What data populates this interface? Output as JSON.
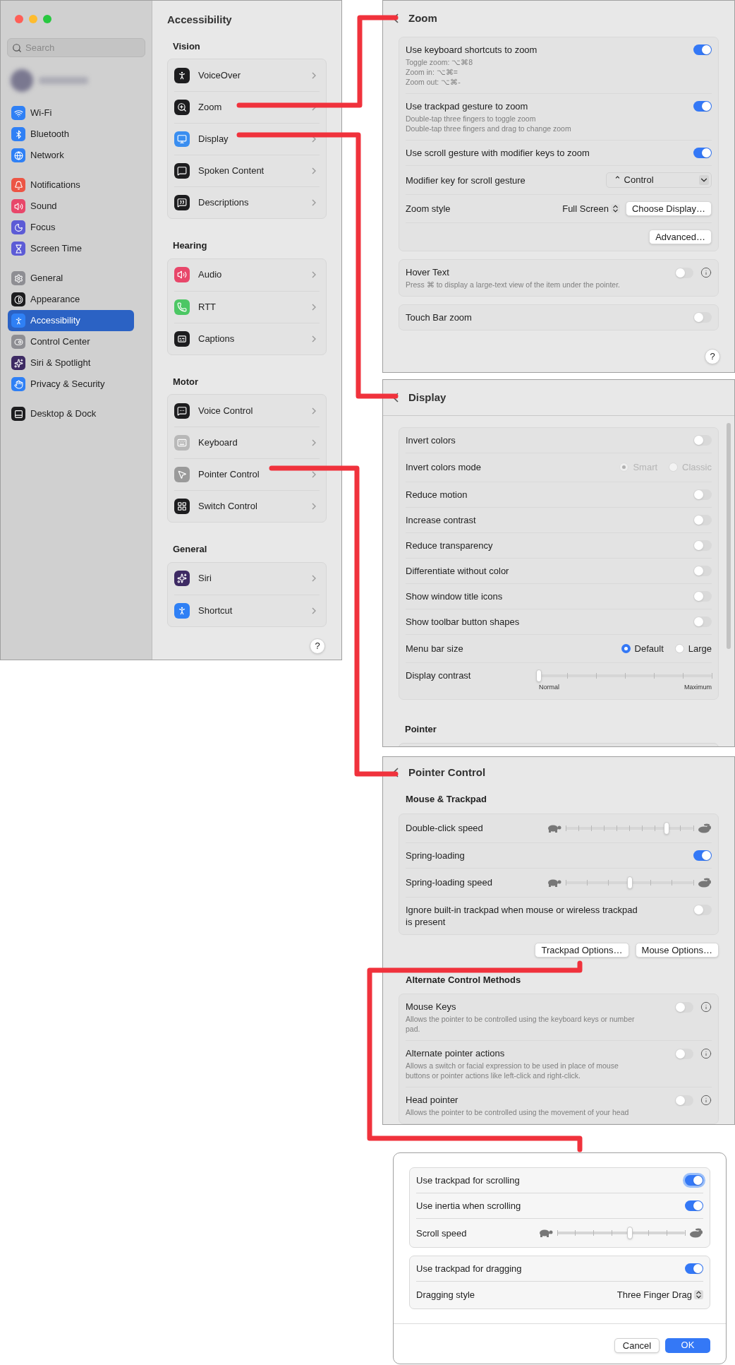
{
  "main_window": {
    "sidebar": {
      "search": {
        "placeholder": "Search"
      },
      "groups": [
        {
          "items": [
            {
              "label": "Wi-Fi",
              "color": "#2f80f5",
              "selected": false
            },
            {
              "label": "Bluetooth",
              "color": "#2f80f5",
              "selected": false
            },
            {
              "label": "Network",
              "color": "#2f80f5",
              "selected": false
            }
          ]
        },
        {
          "items": [
            {
              "label": "Notifications",
              "color": "#ec5545",
              "selected": false
            },
            {
              "label": "Sound",
              "color": "#e8476a",
              "selected": false
            },
            {
              "label": "Focus",
              "color": "#5c5bd6",
              "selected": false
            },
            {
              "label": "Screen Time",
              "color": "#5c5bd6",
              "selected": false
            }
          ]
        },
        {
          "items": [
            {
              "label": "General",
              "color": "#8e8e93",
              "selected": false
            },
            {
              "label": "Appearance",
              "color": "#1d1d1f",
              "selected": false
            },
            {
              "label": "Accessibility",
              "color": "#2f80f5",
              "selected": true
            },
            {
              "label": "Control Center",
              "color": "#8e8e93",
              "selected": false
            },
            {
              "label": "Siri & Spotlight",
              "color": "#3d2a63",
              "selected": false
            },
            {
              "label": "Privacy & Security",
              "color": "#2f80f5",
              "selected": false
            }
          ]
        },
        {
          "items": [
            {
              "label": "Desktop & Dock",
              "color": "#1d1d1f",
              "selected": false
            }
          ]
        }
      ]
    },
    "content": {
      "title": "Accessibility",
      "sections": [
        {
          "heading": "Vision",
          "items": [
            {
              "label": "VoiceOver",
              "color": "#1d1d1f"
            },
            {
              "label": "Zoom",
              "color": "#1d1d1f"
            },
            {
              "label": "Display",
              "color": "#3a8ef0"
            },
            {
              "label": "Spoken Content",
              "color": "#1d1d1f"
            },
            {
              "label": "Descriptions",
              "color": "#1d1d1f"
            }
          ]
        },
        {
          "heading": "Hearing",
          "items": [
            {
              "label": "Audio",
              "color": "#e8476a"
            },
            {
              "label": "RTT",
              "color": "#4cc764"
            },
            {
              "label": "Captions",
              "color": "#1d1d1f"
            }
          ]
        },
        {
          "heading": "Motor",
          "items": [
            {
              "label": "Voice Control",
              "color": "#1d1d1f"
            },
            {
              "label": "Keyboard",
              "color": "#b8b8b8"
            },
            {
              "label": "Pointer Control",
              "color": "#9a9a9a"
            },
            {
              "label": "Switch Control",
              "color": "#1d1d1f"
            }
          ]
        },
        {
          "heading": "General",
          "items": [
            {
              "label": "Siri",
              "color": "#3d2a63"
            },
            {
              "label": "Shortcut",
              "color": "#2f80f5"
            }
          ]
        }
      ],
      "help": "?"
    }
  },
  "zoom_panel": {
    "title": "Zoom",
    "groups": [
      {
        "rows": [
          {
            "kind": "toggle",
            "label": "Use keyboard shortcuts to zoom",
            "details": [
              "Toggle zoom: ⌥⌘8",
              "Zoom in: ⌥⌘=",
              "Zoom out: ⌥⌘-"
            ],
            "on": true
          },
          {
            "kind": "toggle",
            "label": "Use trackpad gesture to zoom",
            "details": [
              "Double-tap three fingers to toggle zoom",
              "Double-tap three fingers and drag to change zoom"
            ],
            "on": true
          },
          {
            "kind": "toggle",
            "label": "Use scroll gesture with modifier keys to zoom",
            "on": true
          },
          {
            "kind": "dropdown",
            "label": "Modifier key for scroll gesture",
            "value": "⌃ Control"
          },
          {
            "kind": "popup",
            "label": "Zoom style",
            "value": "Full Screen",
            "button": "Choose Display…"
          },
          {
            "kind": "button",
            "button": "Advanced…"
          }
        ]
      },
      {
        "rows": [
          {
            "kind": "toggle",
            "label": "Hover Text",
            "details": [
              "Press ⌘ to display a large-text view of the item under the pointer."
            ],
            "on": false,
            "info": true
          }
        ]
      },
      {
        "rows": [
          {
            "kind": "toggle",
            "label": "Touch Bar zoom",
            "on": false
          }
        ]
      }
    ],
    "help": "?"
  },
  "display_panel": {
    "title": "Display",
    "groups": [
      {
        "rows": [
          {
            "kind": "toggle",
            "label": "Invert colors",
            "on": false
          },
          {
            "kind": "radio",
            "label": "Invert colors mode",
            "disabled": true,
            "options": [
              {
                "label": "Smart",
                "selected": true
              },
              {
                "label": "Classic",
                "selected": false
              }
            ]
          },
          {
            "kind": "toggle",
            "label": "Reduce motion",
            "on": false
          },
          {
            "kind": "toggle",
            "label": "Increase contrast",
            "on": false
          },
          {
            "kind": "toggle",
            "label": "Reduce transparency",
            "on": false
          },
          {
            "kind": "toggle",
            "label": "Differentiate without color",
            "on": false
          },
          {
            "kind": "toggle",
            "label": "Show window title icons",
            "on": false
          },
          {
            "kind": "toggle",
            "label": "Show toolbar button shapes",
            "on": false
          },
          {
            "kind": "radio",
            "label": "Menu bar size",
            "disabled": false,
            "options": [
              {
                "label": "Default",
                "selected": true
              },
              {
                "label": "Large",
                "selected": false
              }
            ]
          },
          {
            "kind": "slider",
            "label": "Display contrast",
            "level": 0,
            "min_label": "Normal",
            "max_label": "Maximum"
          }
        ]
      }
    ],
    "next_heading": "Pointer"
  },
  "pointer_panel": {
    "title": "Pointer Control",
    "sections": [
      {
        "heading": "Mouse & Trackpad",
        "rows": [
          {
            "kind": "speed",
            "label": "Double-click speed",
            "level": 0.79
          },
          {
            "kind": "toggle",
            "label": "Spring-loading",
            "on": true
          },
          {
            "kind": "speed",
            "label": "Spring-loading speed",
            "level": 0.5
          },
          {
            "kind": "toggle",
            "label": "Ignore built-in trackpad when mouse or wireless trackpad is present",
            "on": false
          }
        ],
        "buttons": [
          "Trackpad Options…",
          "Mouse Options…"
        ]
      },
      {
        "heading": "Alternate Control Methods",
        "rows": [
          {
            "kind": "toggle",
            "label": "Mouse Keys",
            "details": [
              "Allows the pointer to be controlled using the keyboard keys or number pad."
            ],
            "on": false,
            "info": true
          },
          {
            "kind": "toggle",
            "label": "Alternate pointer actions",
            "details": [
              "Allows a switch or facial expression to be used in place of mouse buttons or pointer actions like left-click and right-click."
            ],
            "on": false,
            "info": true
          },
          {
            "kind": "toggle",
            "label": "Head pointer",
            "details": [
              "Allows the pointer to be controlled using the movement of your head"
            ],
            "on": false,
            "info": true
          }
        ]
      }
    ]
  },
  "trackpad_dialog": {
    "groups": [
      {
        "rows": [
          {
            "kind": "toggle",
            "label": "Use trackpad for scrolling",
            "on": true,
            "focused": true
          },
          {
            "kind": "toggle",
            "label": "Use inertia when scrolling",
            "on": true,
            "focused": false
          },
          {
            "kind": "speed",
            "label": "Scroll speed",
            "level": 0.57
          }
        ]
      },
      {
        "rows": [
          {
            "kind": "toggle",
            "label": "Use trackpad for dragging",
            "on": true,
            "focused": false
          },
          {
            "kind": "popup",
            "label": "Dragging style",
            "value": "Three Finger Drag"
          }
        ]
      }
    ],
    "buttons": [
      {
        "label": "Cancel",
        "primary": false
      },
      {
        "label": "OK",
        "primary": true
      }
    ]
  }
}
